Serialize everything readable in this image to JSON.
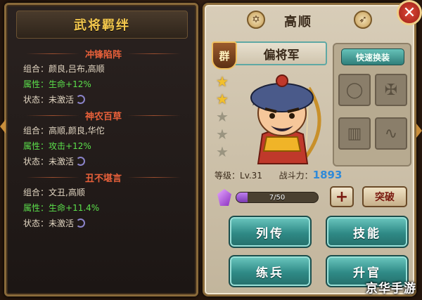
{
  "left": {
    "title": "武将羁绊",
    "groups": [
      {
        "name": "冲锋陷阵",
        "combo_label": "组合：",
        "combo_value": "颜良,吕布,高顺",
        "attr_label": "属性：",
        "attr_value": "生命+12%",
        "status_label": "状态：",
        "status_value": "未激活"
      },
      {
        "name": "神农百草",
        "combo_label": "组合：",
        "combo_value": "高顺,颜良,华佗",
        "attr_label": "属性：",
        "attr_value": "攻击+12%",
        "status_label": "状态：",
        "status_value": "未激活"
      },
      {
        "name": "丑不堪言",
        "combo_label": "组合：",
        "combo_value": "文丑,高顺",
        "attr_label": "属性：",
        "attr_value": "生命+11.4%",
        "status_label": "状态：",
        "status_value": "未激活"
      }
    ]
  },
  "right": {
    "hero_name": "高顺",
    "faction": "群",
    "rank": "偏将军",
    "stars_total": 5,
    "stars_lit": 2,
    "quick_equip_label": "快速换装",
    "level_label": "等级：",
    "level_value": "Lv.31",
    "power_label": "战斗力：",
    "power_value": "1893",
    "exp_text": "7/50",
    "exp_fraction": 0.14,
    "plus_label": "+",
    "break_label": "突破",
    "buttons": {
      "biography": "列传",
      "skills": "技能",
      "train": "练兵",
      "promote": "升官"
    }
  },
  "watermark": "京华手游",
  "colors": {
    "accent_gold": "#f3c74d",
    "group_title": "#e8603a",
    "attr_green": "#5be04b",
    "teal_button": "#2f8a86",
    "power_blue": "#2f8ad8"
  }
}
